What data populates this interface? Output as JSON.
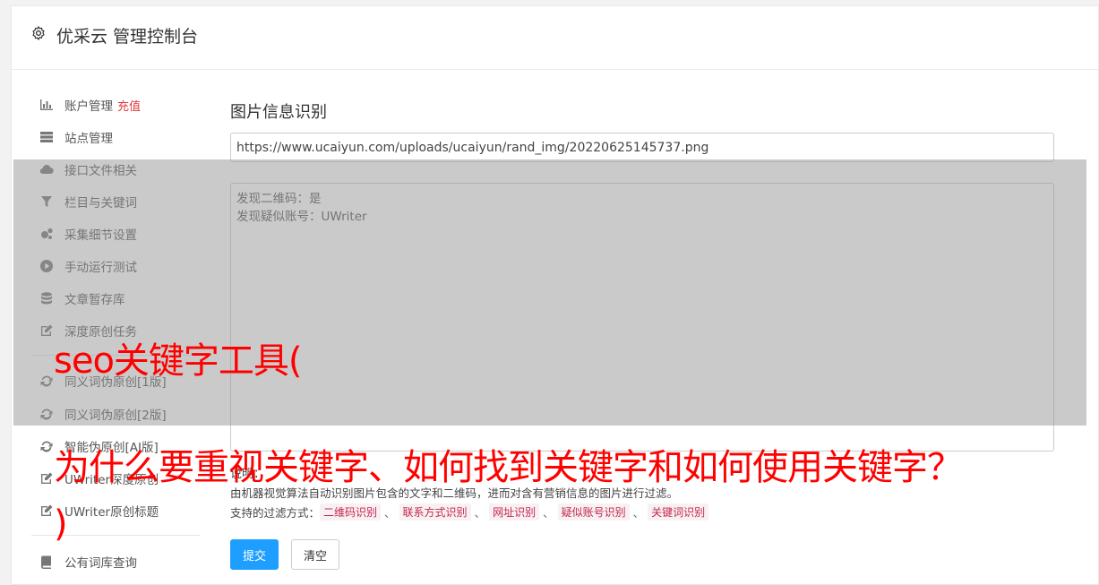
{
  "header": {
    "title": "优采云 管理控制台",
    "icon": "gear-icon"
  },
  "sidebar": {
    "items": [
      {
        "label": "账户管理",
        "extra": "充值",
        "icon": "bar-chart-icon"
      },
      {
        "label": "站点管理",
        "icon": "server-icon"
      },
      {
        "label": "接口文件相关",
        "icon": "cloud-upload-icon"
      },
      {
        "label": "栏目与关键词",
        "icon": "filter-icon"
      },
      {
        "label": "采集细节设置",
        "icon": "cogs-icon"
      },
      {
        "label": "手动运行测试",
        "icon": "play-circle-icon"
      },
      {
        "label": "文章暂存库",
        "icon": "database-icon"
      },
      {
        "label": "深度原创任务",
        "icon": "edit-icon"
      },
      {
        "label": "同义词伪原创[1版]",
        "icon": "refresh-icon"
      },
      {
        "label": "同义词伪原创[2版]",
        "icon": "refresh-icon"
      },
      {
        "label": "智能伪原创[AI版]",
        "icon": "refresh-icon"
      },
      {
        "label": "UWriter深度原创",
        "icon": "edit-icon"
      },
      {
        "label": "UWriter原创标题",
        "icon": "edit-icon"
      },
      {
        "label": "公有词库查询",
        "icon": "book-icon"
      }
    ]
  },
  "main": {
    "title": "图片信息识别",
    "url_value": "https://www.ucaiyun.com/uploads/ucaiyun/rand_img/20220625145737.png",
    "result_lines": [
      "发现二维码：是",
      "发现疑似账号：UWriter"
    ],
    "desc_title": "说明：",
    "desc_text": "由机器视觉算法自动识别图片包含的文字和二维码，进而对含有营销信息的图片进行过滤。",
    "filter_label": "支持的过滤方式：",
    "filters": [
      "二维码识别",
      "联系方式识别",
      "网址识别",
      "疑似账号识别",
      "关键词识别"
    ],
    "filter_sep": "、",
    "submit_label": "提交",
    "clear_label": "清空"
  },
  "overlay": {
    "line1": "seo关键字工具(",
    "line2": "为什么要重视关键字、如何找到关键字和如何使用关键字？",
    "line3": ")"
  }
}
